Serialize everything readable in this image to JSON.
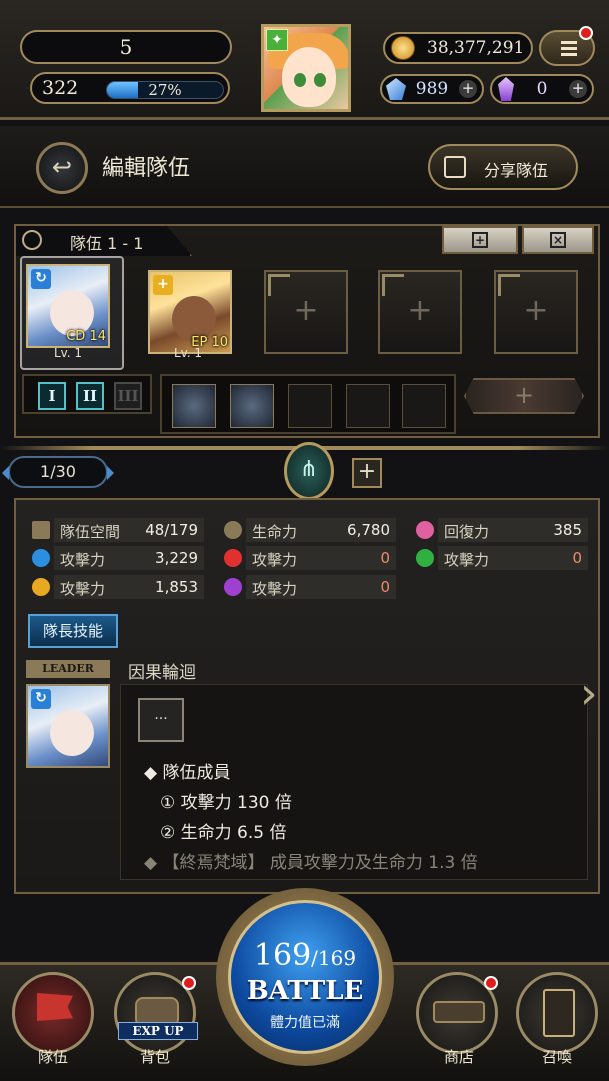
{
  "top": {
    "level": "5",
    "stamina": "322",
    "stamina_percent": "27%",
    "stamina_fraction": 0.27,
    "gold": "38,377,291",
    "gems": "989",
    "crystals": "0"
  },
  "header": {
    "title": "編輯隊伍",
    "share_label": "分享隊伍"
  },
  "team": {
    "tab_label": "隊伍 1 - 1",
    "members": [
      {
        "badge": "CD 14",
        "level": "Lv. 1",
        "element": "water",
        "element_color": "#2a7fd6"
      },
      {
        "badge": "EP 10",
        "level": "Lv. 1",
        "element": "light",
        "element_color": "#e8b020"
      }
    ],
    "formation_buttons": [
      "I",
      "II",
      "III"
    ]
  },
  "nav": {
    "page_indicator": "1/30"
  },
  "stats": {
    "row1": [
      {
        "label": "隊伍空間",
        "value": "48/179",
        "icon": "space-flag-icon",
        "color": "#8a7a58"
      },
      {
        "label": "生命力",
        "value": "6,780",
        "icon": "hp-drop-icon",
        "color": "#8a7a58"
      },
      {
        "label": "回復力",
        "value": "385",
        "icon": "heart-icon",
        "color": "#e060a0"
      }
    ],
    "row2": [
      {
        "label": "攻擊力",
        "value": "3,229",
        "icon": "water-icon",
        "color": "#2a8fe0"
      },
      {
        "label": "攻擊力",
        "value": "0",
        "icon": "fire-icon",
        "color": "#e03030"
      },
      {
        "label": "攻擊力",
        "value": "0",
        "icon": "earth-icon",
        "color": "#30b040"
      }
    ],
    "row3": [
      {
        "label": "攻擊力",
        "value": "1,853",
        "icon": "light-icon",
        "color": "#e8a820"
      },
      {
        "label": "攻擊力",
        "value": "0",
        "icon": "dark-icon",
        "color": "#a040d0"
      }
    ]
  },
  "leader": {
    "skill_button": "隊長技能",
    "badge": "LEADER",
    "skill_name": "因果輪迴",
    "dots": "···",
    "lines": [
      "◆ 隊伍成員",
      "① 攻擊力 130 倍",
      "② 生命力 6.5 倍",
      "◆ 【終焉梵域】 成員攻擊力及生命力 1.3 倍"
    ]
  },
  "bottom_nav": {
    "team": "隊伍",
    "backpack": "背包",
    "exp_up": "EXP UP",
    "battle_stamina": "169",
    "battle_stamina_max": "/169",
    "battle": "BATTLE",
    "battle_sub": "體力值已滿",
    "shop": "商店",
    "summon": "召喚"
  }
}
